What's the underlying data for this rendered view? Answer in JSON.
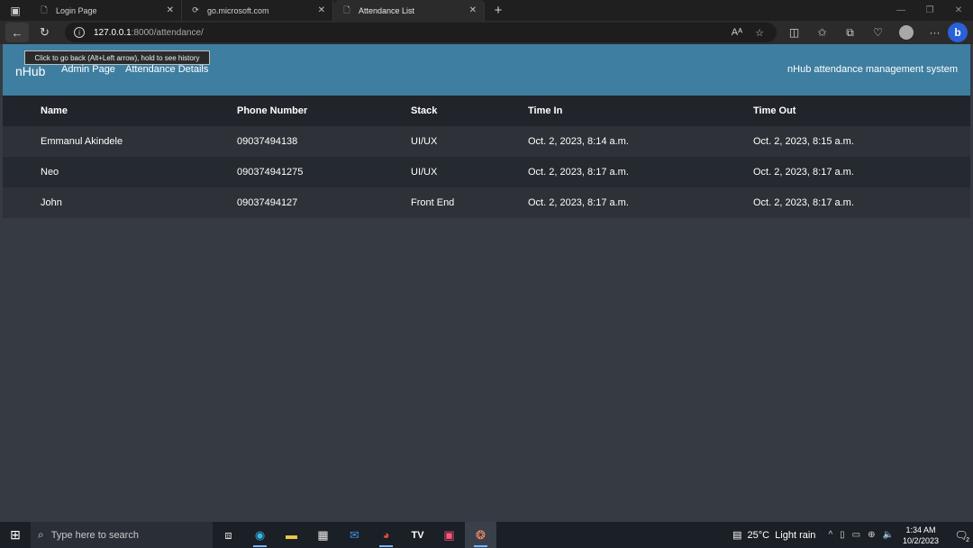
{
  "browser": {
    "tabs": [
      {
        "label": "Login Page",
        "icon": "page-icon",
        "close": "✕"
      },
      {
        "label": "go.microsoft.com",
        "icon": "redirect-page-icon",
        "close": "✕"
      },
      {
        "label": "Attendance List",
        "icon": "page-icon",
        "close": "✕",
        "active": true
      }
    ],
    "new_tab_label": "+",
    "url_host": "127.0.0.1",
    "url_path": ":8000/attendance/",
    "tooltip": "Click to go back (Alt+Left arrow), hold to see history"
  },
  "site": {
    "brand": "nHub",
    "nav": {
      "admin": "Admin Page",
      "attendance": "Attendance Details"
    },
    "system_name": "nHub attendance management system",
    "colors": {
      "navbar": "#3e7ea0",
      "background": "#363b43"
    }
  },
  "table": {
    "headers": {
      "name": "Name",
      "phone": "Phone Number",
      "stack": "Stack",
      "time_in": "Time In",
      "time_out": "Time Out"
    },
    "rows": [
      {
        "name": "Emmanul Akindele",
        "phone": "09037494138",
        "stack": "UI/UX",
        "time_in": "Oct. 2, 2023, 8:14 a.m.",
        "time_out": "Oct. 2, 2023, 8:15 a.m."
      },
      {
        "name": "Neo",
        "phone": "090374941275",
        "stack": "UI/UX",
        "time_in": "Oct. 2, 2023, 8:17 a.m.",
        "time_out": "Oct. 2, 2023, 8:17 a.m."
      },
      {
        "name": "John",
        "phone": "09037494127",
        "stack": "Front End",
        "time_in": "Oct. 2, 2023, 8:17 a.m.",
        "time_out": "Oct. 2, 2023, 8:17 a.m."
      }
    ]
  },
  "taskbar": {
    "search_placeholder": "Type here to search",
    "weather_temp": "25°C",
    "weather_text": "Light rain",
    "time": "1:34 AM",
    "date": "10/2/2023",
    "notification_count": "2"
  }
}
